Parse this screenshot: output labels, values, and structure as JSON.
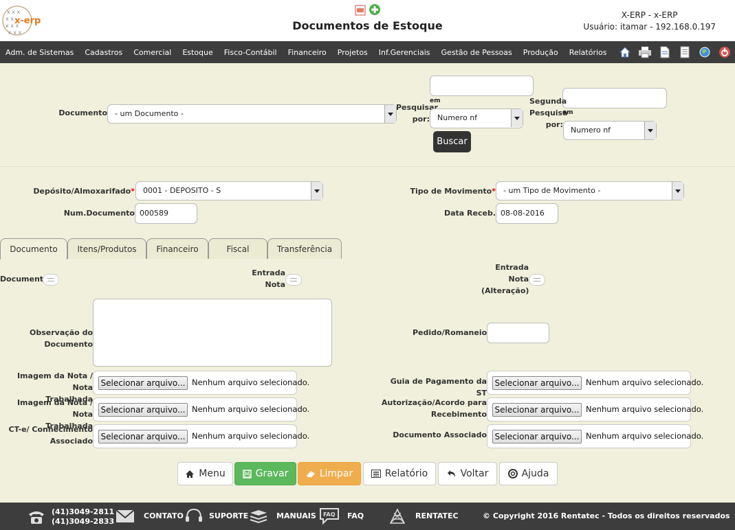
{
  "header": {
    "title": "Documentos de Estoque",
    "logo_text": "x-erp",
    "system": "X-ERP - x-ERP",
    "user": "Usuário: itamar - 192.168.0.197"
  },
  "menu": [
    "Adm. de Sistemas",
    "Cadastros",
    "Comercial",
    "Estoque",
    "Fisco-Contábil",
    "Financeiro",
    "Projetos",
    "Inf.Gerenciais",
    "Gestão de Pessoas",
    "Produção",
    "Relatórios"
  ],
  "menu_icons": [
    "home-icon",
    "printer-icon",
    "document-icon",
    "notes-icon",
    "globe-icon",
    "power-icon"
  ],
  "search": {
    "documento_label": "Documento",
    "documento_value": "- um Documento -",
    "pesquisar_label_1": "Pesquisar",
    "pesquisar_label_2": "por:",
    "em_label": "em",
    "pesquisar_em_value": "Numero nf",
    "segunda_label_1": "Segunda",
    "segunda_label_2": "Pesquisa",
    "segunda_label_3": "por:",
    "segunda_em_label": "em",
    "segunda_em_value": "Numero nf",
    "buscar_label": "Buscar"
  },
  "form": {
    "deposito_label": "Depósito/Almoxarifado",
    "deposito_value": "0001 - DEPOSITO - S",
    "tipo_label": "Tipo de Movimento",
    "tipo_value": "- um Tipo de Movimento -",
    "num_doc_label": "Num.Documento",
    "num_doc_value": "000589",
    "data_label": "Data Receb.",
    "data_value": "08-08-2016",
    "required_mark": "*"
  },
  "tabs": [
    "Documento",
    "Itens/Produtos",
    "Financeiro",
    "Fiscal",
    "Transferência"
  ],
  "doc_tab": {
    "documentos_label": "Documentos",
    "entrada_nota_1": "Entrada",
    "entrada_nota_2": "Nota",
    "entrada_alt_1": "Entrada",
    "entrada_alt_2": "Nota",
    "entrada_alt_3": "(Alteração)",
    "obs_label": "Observação do Documento",
    "pedido_label": "Pedido/Romaneio",
    "file_button": "Selecionar arquivo...",
    "file_none": "Nenhum arquivo selecionado.",
    "img1_label_1": "Imagem da Nota / Nota",
    "img1_label_2": "Trabalhada",
    "img2_label_1": "Imagem da Nota / Nota",
    "img2_label_2": "Trabalhada",
    "cte_label_1": "CT-e/ Conhecimento",
    "cte_label_2": "Associado",
    "guia_label": "Guia de Pagamento da ST",
    "aut_label_1": "Autorização/Acordo para",
    "aut_label_2": "Recebimento",
    "docassoc_label": "Documento Associado"
  },
  "buttons": {
    "menu": "Menu",
    "gravar": "Gravar",
    "limpar": "Limpar",
    "relatorio": "Relatório",
    "voltar": "Voltar",
    "ajuda": "Ajuda"
  },
  "colors": {
    "gravar": "#5cb85c",
    "limpar": "#f0ad4e",
    "menubar": "#3d3d3d",
    "required": "#ee0000"
  },
  "footer": {
    "phone1": "(41)3049-2811",
    "phone2": "(41)3049-2833",
    "contato": "CONTATO",
    "suporte": "SUPORTE",
    "manuais": "MANUAIS",
    "faq": "FAQ",
    "rentatec": "RENTATEC",
    "copyright": "© Copyright 2016 Rentatec - Todos os direitos reservados"
  }
}
